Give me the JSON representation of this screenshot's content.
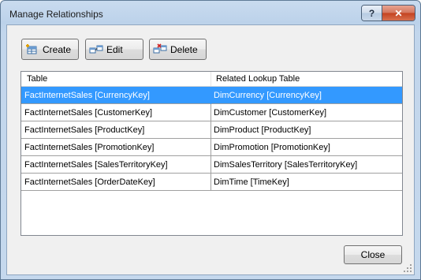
{
  "window": {
    "title": "Manage Relationships",
    "help_glyph": "?",
    "close_glyph": "✕"
  },
  "toolbar": {
    "create_label": "Create",
    "edit_label": "Edit",
    "delete_label": "Delete"
  },
  "grid": {
    "columns": [
      "Table",
      "Related Lookup Table"
    ],
    "selected_row": 0,
    "rows": [
      {
        "table": "FactInternetSales [CurrencyKey]",
        "lookup": "DimCurrency [CurrencyKey]"
      },
      {
        "table": "FactInternetSales [CustomerKey]",
        "lookup": "DimCustomer [CustomerKey]"
      },
      {
        "table": "FactInternetSales [ProductKey]",
        "lookup": "DimProduct [ProductKey]"
      },
      {
        "table": "FactInternetSales [PromotionKey]",
        "lookup": "DimPromotion [PromotionKey]"
      },
      {
        "table": "FactInternetSales [SalesTerritoryKey]",
        "lookup": "DimSalesTerritory [SalesTerritoryKey]"
      },
      {
        "table": "FactInternetSales [OrderDateKey]",
        "lookup": "DimTime [TimeKey]"
      }
    ]
  },
  "footer": {
    "close_label": "Close"
  },
  "colors": {
    "selection": "#3399ff",
    "title_bar": "#c9dbef",
    "close_button": "#c4421f"
  },
  "icons": {
    "create": "table-add-icon",
    "edit": "table-edit-icon",
    "delete": "table-delete-icon"
  }
}
